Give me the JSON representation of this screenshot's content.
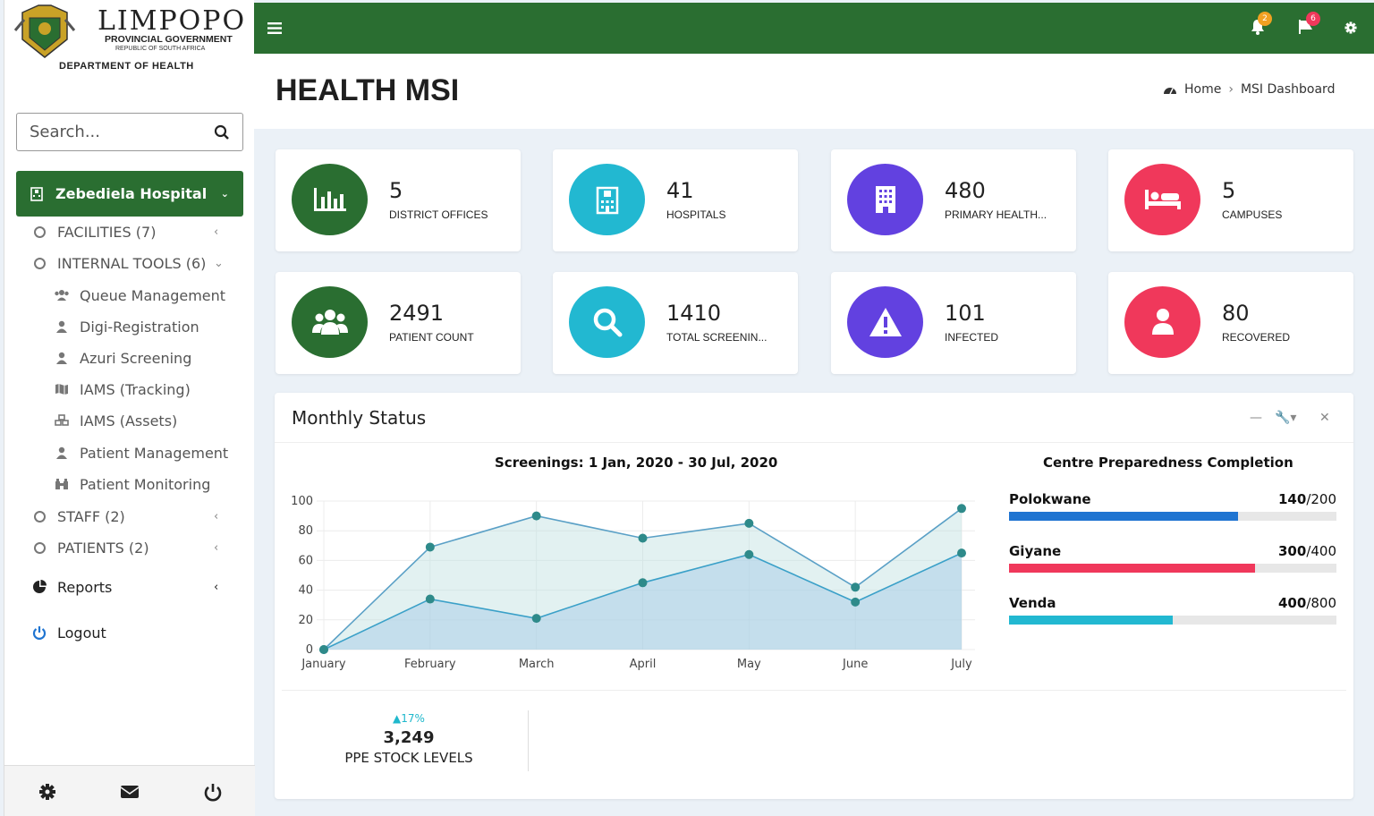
{
  "brand": {
    "name": "LIMPOPO",
    "line2": "PROVINCIAL GOVERNMENT",
    "line3": "REPUBLIC OF SOUTH AFRICA",
    "line4": "DEPARTMENT OF HEALTH"
  },
  "search": {
    "placeholder": "Search..."
  },
  "sidebar": {
    "hospital": "Zebediela Hospital",
    "items": [
      {
        "label": "FACILITIES (7)"
      },
      {
        "label": "INTERNAL TOOLS (6)"
      },
      {
        "label": "Queue Management"
      },
      {
        "label": "Digi-Registration"
      },
      {
        "label": "Azuri Screening"
      },
      {
        "label": "IAMS (Tracking)"
      },
      {
        "label": "IAMS (Assets)"
      },
      {
        "label": "Patient Management"
      },
      {
        "label": "Patient Monitoring"
      },
      {
        "label": "STAFF (2)"
      },
      {
        "label": "PATIENTS (2)"
      },
      {
        "label": "Reports"
      },
      {
        "label": "Logout"
      }
    ]
  },
  "topbar": {
    "notif_count": "2",
    "flag_count": "6"
  },
  "page": {
    "title": "HEALTH MSI",
    "breadcrumb": [
      "Home",
      "MSI Dashboard"
    ]
  },
  "cards": [
    {
      "value": "5",
      "label": "DISTRICT OFFICES",
      "color": "#2a6e31",
      "icon": "bar-chart-icon"
    },
    {
      "value": "41",
      "label": "HOSPITALS",
      "color": "#22b8d1",
      "icon": "hospital-icon"
    },
    {
      "value": "480",
      "label": "PRIMARY HEALTH...",
      "color": "#6241e0",
      "icon": "building-icon"
    },
    {
      "value": "5",
      "label": "CAMPUSES",
      "color": "#f0385b",
      "icon": "bed-icon"
    },
    {
      "value": "2491",
      "label": "PATIENT COUNT",
      "color": "#2a6e31",
      "icon": "users-icon"
    },
    {
      "value": "1410",
      "label": "TOTAL SCREENIN...",
      "color": "#22b8d1",
      "icon": "search-icon"
    },
    {
      "value": "101",
      "label": "INFECTED",
      "color": "#6241e0",
      "icon": "warning-icon"
    },
    {
      "value": "80",
      "label": "RECOVERED",
      "color": "#f0385b",
      "icon": "user-icon"
    }
  ],
  "panel": {
    "title": "Monthly Status",
    "prep_title": "Centre Preparedness Completion"
  },
  "chart_data": {
    "type": "area",
    "title": "Screenings: 1 Jan, 2020 - 30 Jul, 2020",
    "categories": [
      "January",
      "February",
      "March",
      "April",
      "May",
      "June",
      "July"
    ],
    "ylim": [
      0,
      100
    ],
    "yticks": [
      "0",
      "20",
      "40",
      "60",
      "80",
      "100"
    ],
    "series": [
      {
        "values": [
          0,
          69,
          90,
          75,
          85,
          42,
          95
        ],
        "color": "#2e8a8a"
      },
      {
        "values": [
          0,
          34,
          21,
          45,
          64,
          32,
          65
        ],
        "color": "#2e8a8a"
      }
    ],
    "grid": true
  },
  "preparedness": [
    {
      "name": "Polokwane",
      "value": "140",
      "total": "/200",
      "fraction": 0.7,
      "color": "#1f74d1"
    },
    {
      "name": "Giyane",
      "value": "300",
      "total": "/400",
      "fraction": 0.75,
      "color": "#f0385b"
    },
    {
      "name": "Venda",
      "value": "400",
      "total": "/800",
      "fraction": 0.5,
      "color": "#22b8d1"
    }
  ],
  "stat": {
    "change": "17%",
    "value": "3,249",
    "label": "PPE STOCK LEVELS"
  }
}
